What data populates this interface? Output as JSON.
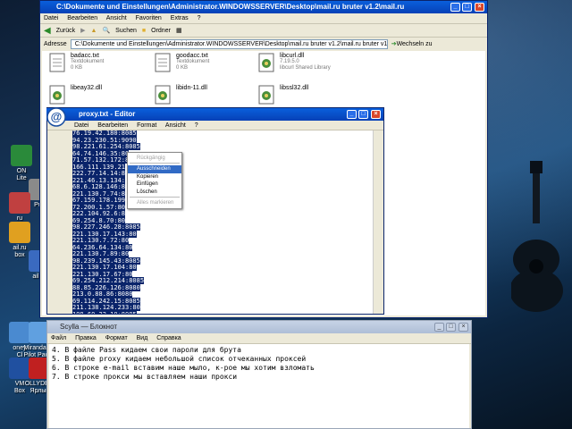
{
  "desktop": {
    "icons": [
      {
        "label": "ON\nLite"
      },
      {
        "label": "Pull"
      },
      {
        "label": "ru\nru"
      },
      {
        "label": "ail.ru\nbox"
      },
      {
        "label": "ail.ru"
      },
      {
        "label": "oney\nCl"
      },
      {
        "label": "Miranda IM\nPilot Pack7"
      },
      {
        "label": "VM\nBox"
      },
      {
        "label": "OLLYDBG\nЯрлык"
      }
    ]
  },
  "explorer": {
    "title": "C:\\Dokumente und Einstellungen\\Administrator.WINDOWSSERVER\\Desktop\\mail.ru bruter v1.2\\mail.ru",
    "menu": [
      "Datei",
      "Bearbeiten",
      "Ansicht",
      "Favoriten",
      "Extras",
      "?"
    ],
    "toolbar": {
      "back": "Zurück",
      "search": "Suchen",
      "folders": "Ordner"
    },
    "address_label": "Adresse",
    "address_value": "C:\\Dokumente und Einstellungen\\Administrator.WINDOWSSERVER\\Desktop\\mail.ru bruter v1.2\\mail.ru bruter v1.2",
    "go_label": "Wechseln zu",
    "files": [
      {
        "name": "badacc.txt",
        "type": "Textdokument",
        "size": "0 KB"
      },
      {
        "name": "goodacc.txt",
        "type": "Textdokument",
        "size": "0 KB"
      },
      {
        "name": "libcurl.dll",
        "type": "7.19.5.0",
        "size": "libcurl Shared Library"
      },
      {
        "name": "libeay32.dll",
        "type": "",
        "size": ""
      },
      {
        "name": "libidn-11.dll",
        "type": "",
        "size": ""
      },
      {
        "name": "libssl32.dll",
        "type": "",
        "size": ""
      }
    ]
  },
  "editor": {
    "title": "proxy.txt - Editor",
    "menu": [
      "Datei",
      "Bearbeiten",
      "Format",
      "Ansicht",
      "?"
    ],
    "lines": [
      "76.19.42.180:8085",
      "94.23.230.51:9090",
      "98.221.61.254:8085",
      "64.74.146.35:80",
      "71.57.132.172:8085",
      "166.111.139.21",
      "222.77.14.14:8",
      "221.46.13.134:",
      "68.6.128.146:8",
      "221.130.7.74:8",
      "67.159.178.199",
      "72.200.1.57:80",
      "222.104.92.6:8",
      "69.254.8.70:80",
      "98.227.246.28:8085",
      "221.130.17.143:80",
      "221.130.7.72:80",
      "64.236.64.134:80",
      "221.130.7.89:80",
      "98.239.145.43:8085",
      "221.130.17.104:80",
      "221.130.17.67:80",
      "69.254.212.214:8085",
      "88.85.226.126:8080",
      "213.0.88.86:8080",
      "69.114.242.15:8085",
      "211.138.124.233:80",
      "198.60.22.10:8085",
      "98.210.205.161:8085"
    ]
  },
  "context_menu": {
    "items": [
      {
        "label": "Rückgängig",
        "state": "disabled"
      },
      {
        "label": "Ausschneiden",
        "state": "highlight"
      },
      {
        "label": "Kopieren",
        "state": "normal"
      },
      {
        "label": "Einfügen",
        "state": "normal"
      },
      {
        "label": "Löschen",
        "state": "normal"
      },
      {
        "label": "Alles markieren",
        "state": "disabled"
      }
    ]
  },
  "notepad": {
    "title": "Scylla — Блокнот",
    "menu": [
      "Файл",
      "Правка",
      "Формат",
      "Вид",
      "Справка"
    ],
    "lines": [
      "4. В файле Pass кидаем свои пароли для брута",
      "5. В файле proxy кидаем небольшой список отчеканных проксей",
      "6. В строке e-mail вставим наше мыло, к-рое мы хотим взломать",
      "7. В строке прокси мы вставляем наши прокси"
    ]
  },
  "colors": {
    "selection": "#0a246a",
    "titlebar": "#0a5fdc",
    "menu_highlight": "#316ac5"
  }
}
